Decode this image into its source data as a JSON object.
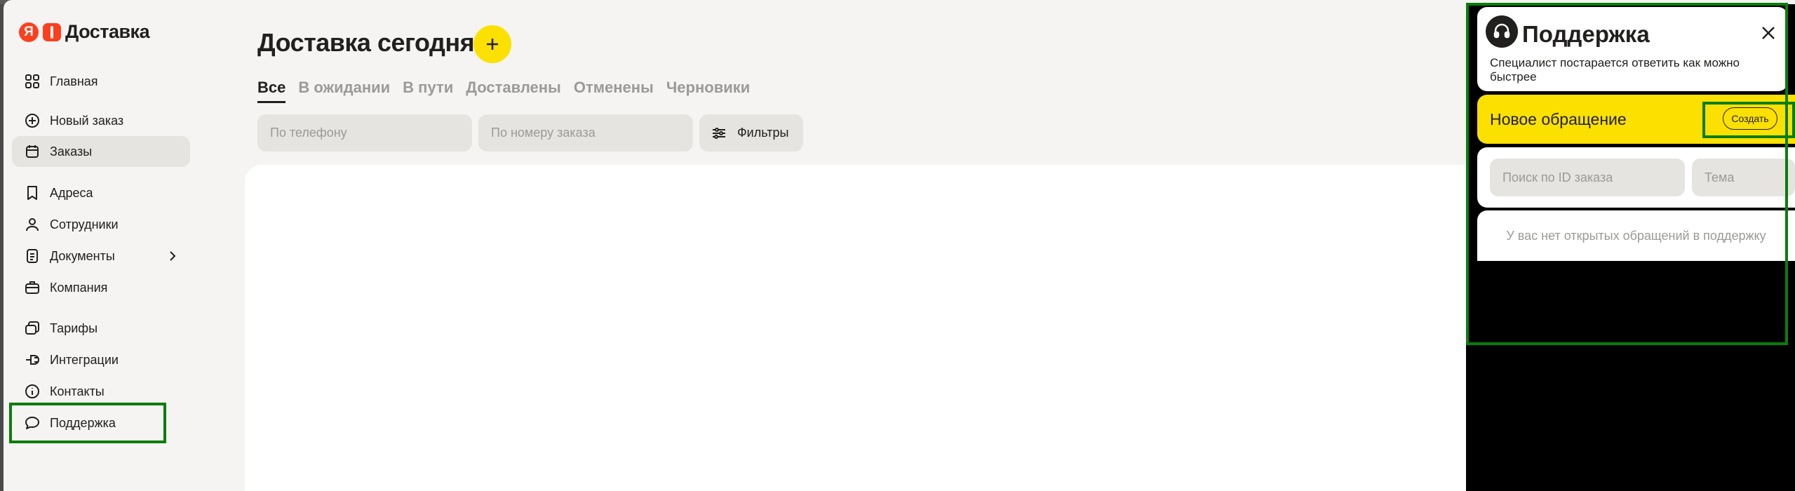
{
  "brand": {
    "logo_letter": "Я",
    "name": "Доставка",
    "color": "#fc3f1d"
  },
  "sidebar": {
    "items": [
      {
        "label": "Главная",
        "icon": "grid-icon"
      },
      {
        "label": "Новый заказ",
        "icon": "plus-circle-icon"
      },
      {
        "label": "Заказы",
        "icon": "calendar-icon",
        "active": true
      },
      {
        "label": "Адреса",
        "icon": "bookmark-icon"
      },
      {
        "label": "Сотрудники",
        "icon": "user-icon"
      },
      {
        "label": "Документы",
        "icon": "document-icon",
        "has_submenu": true
      },
      {
        "label": "Компания",
        "icon": "briefcase-icon"
      },
      {
        "label": "Тарифы",
        "icon": "tag-icon"
      },
      {
        "label": "Интеграции",
        "icon": "plug-icon"
      },
      {
        "label": "Контакты",
        "icon": "info-icon"
      },
      {
        "label": "Поддержка",
        "icon": "chat-bubble-icon"
      }
    ]
  },
  "main": {
    "title": "Доставка сегодня",
    "add_icon": "+",
    "tabs": [
      {
        "label": "Все",
        "active": true
      },
      {
        "label": "В ожидании"
      },
      {
        "label": "В пути"
      },
      {
        "label": "Доставлены"
      },
      {
        "label": "Отменены"
      },
      {
        "label": "Черновики"
      }
    ],
    "search_phone_placeholder": "По телефону",
    "search_order_placeholder": "По номеру заказа",
    "filters_label": "Фильтры"
  },
  "support": {
    "title": "Поддержка",
    "close_icon": "close-icon",
    "description": "Специалист постарается ответить как можно быстрее",
    "new_request_label": "Новое обращение",
    "create_label": "Создать",
    "search_id_placeholder": "Поиск по ID заказа",
    "topic_placeholder": "Тема",
    "empty_text": "У вас нет открытых обращений в поддержку"
  },
  "colors": {
    "accent": "#fce000",
    "highlight": "#0a7d0a",
    "background": "#f5f4f2"
  }
}
